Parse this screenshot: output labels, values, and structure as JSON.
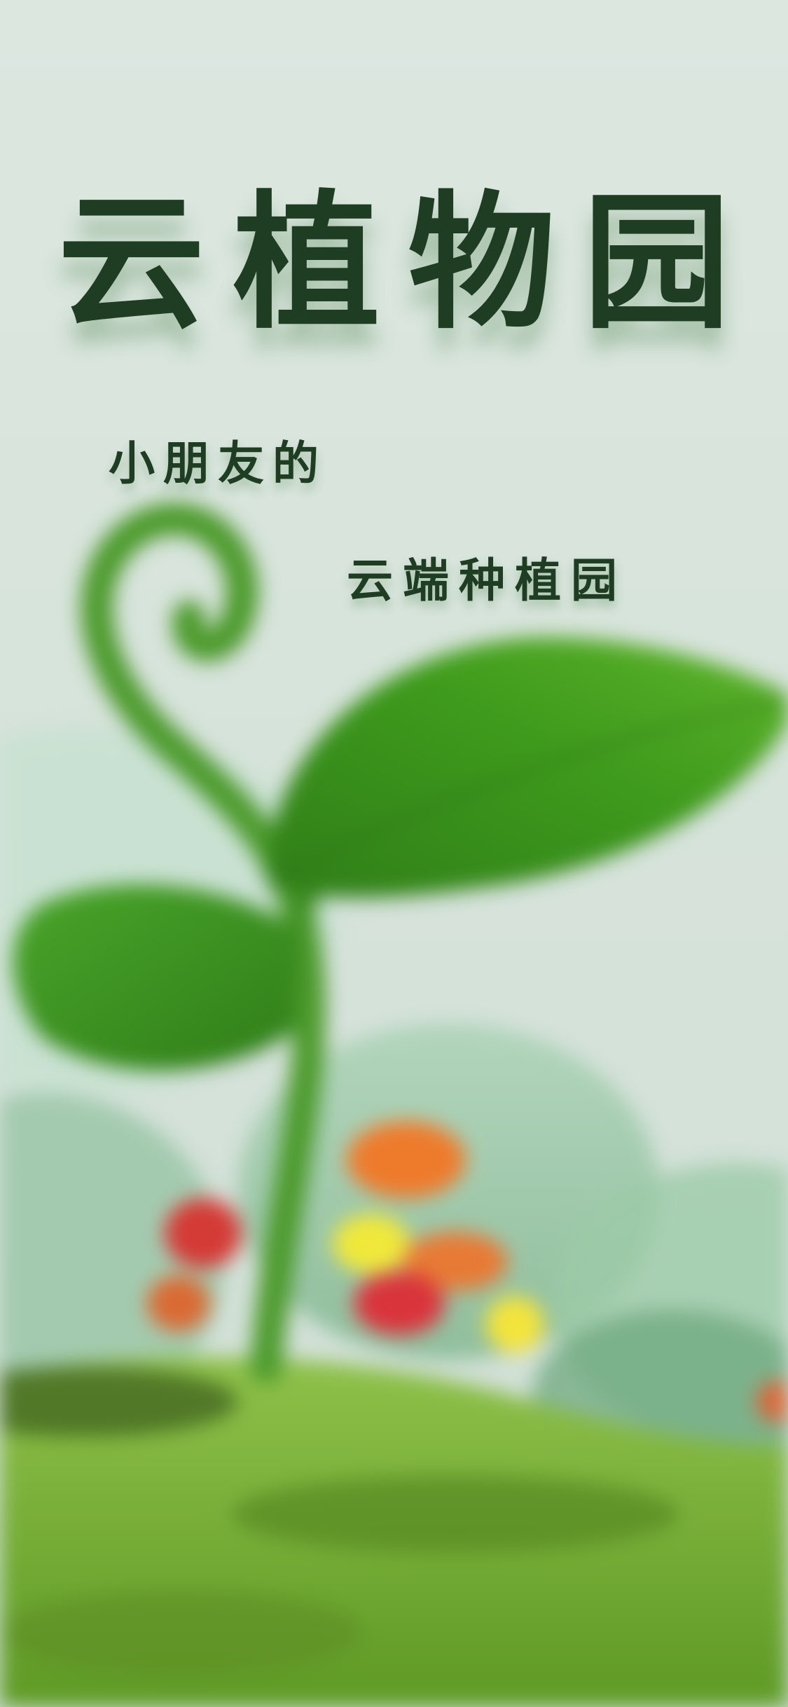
{
  "app": {
    "title": "云植物园",
    "subtitle_line1": "小朋友的",
    "subtitle_line2": "云端种植园"
  },
  "colors": {
    "background": "#dbe6df",
    "title_text": "#1f3d22",
    "leaf_green": "#3f9a1f",
    "ground_green": "#7ab03a"
  },
  "illustration": {
    "subject": "sprout-with-leaves-on-hill",
    "icon": "seedling-icon"
  }
}
